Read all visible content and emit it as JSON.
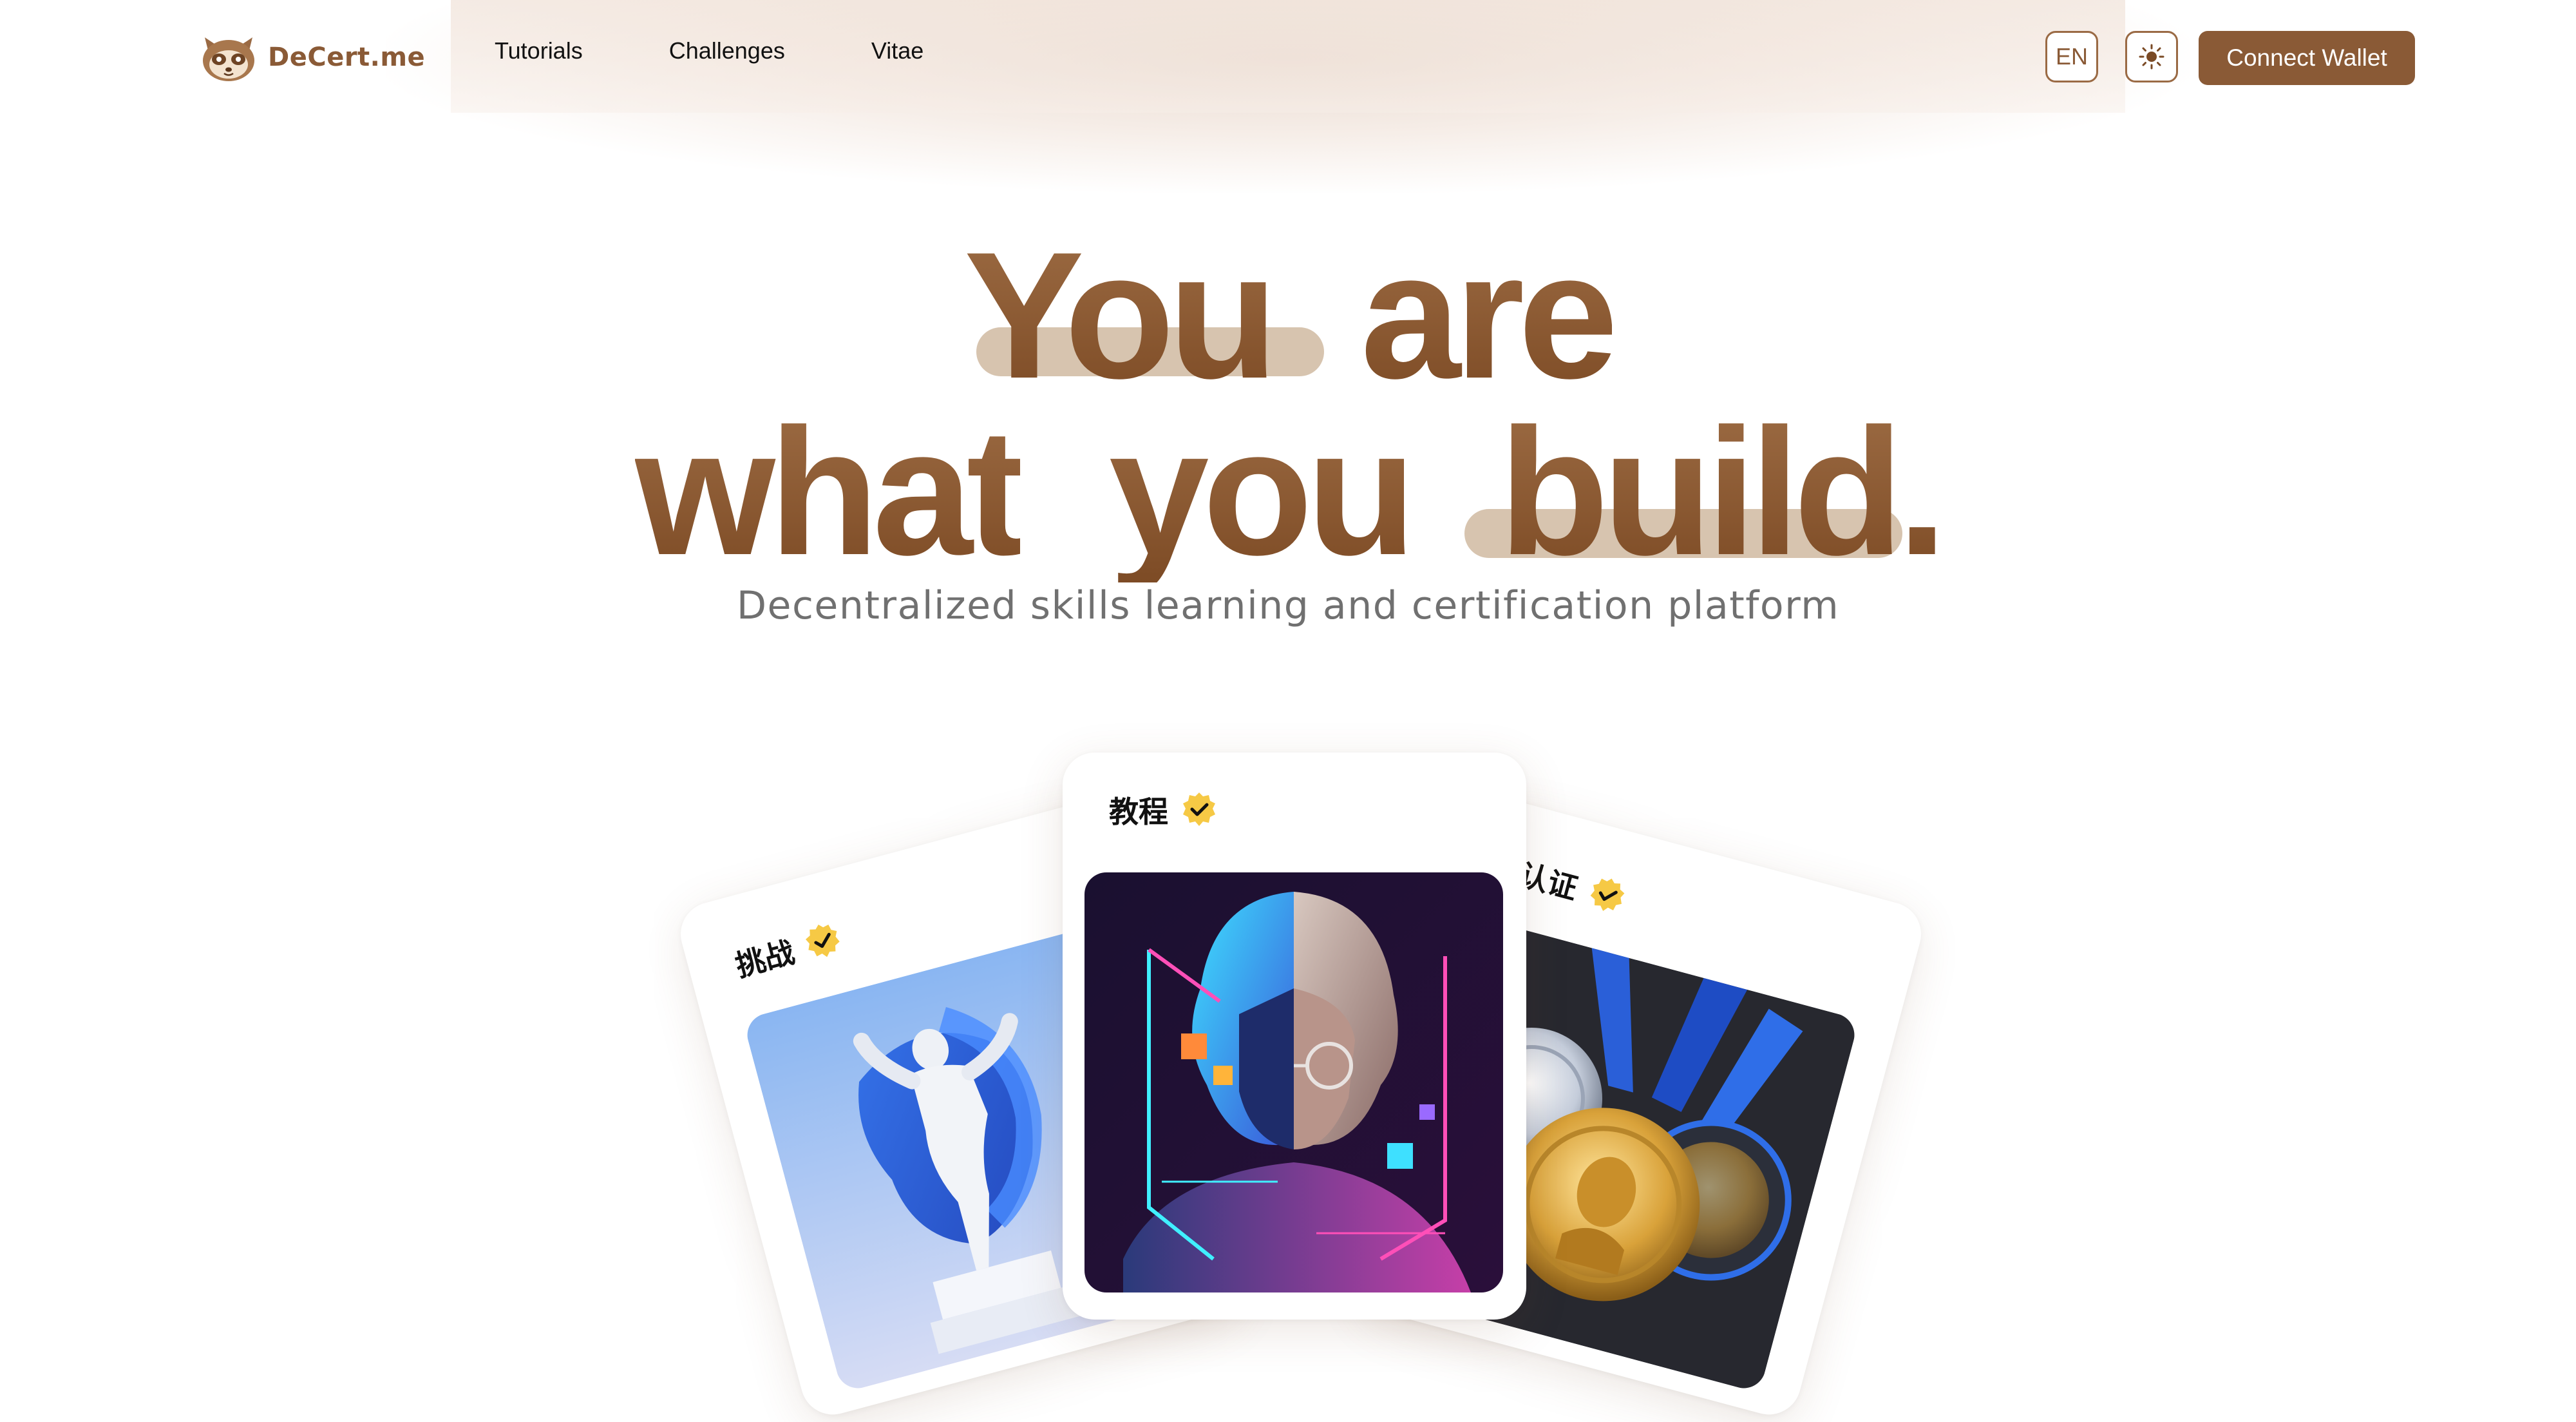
{
  "brand": {
    "name": "DeCert.me"
  },
  "nav": {
    "items": [
      "Tutorials",
      "Challenges",
      "Vitae"
    ]
  },
  "header": {
    "lang_label": "EN",
    "theme_icon": "sun-icon",
    "connect_label": "Connect Wallet"
  },
  "hero": {
    "line1_word1": "You",
    "line1_word2": "are",
    "line2_word1": "what",
    "line2_word2": "you",
    "line2_word3": "build.",
    "subtitle": "Decentralized skills learning and certification platform"
  },
  "cards": [
    {
      "title": "挑战",
      "icon": "verified-badge-icon",
      "image": "statue-image"
    },
    {
      "title": "教程",
      "icon": "verified-badge-icon",
      "image": "neon-portrait-image"
    },
    {
      "title": "认证",
      "icon": "verified-badge-icon",
      "image": "medals-image"
    }
  ],
  "colors": {
    "brand": "#8a5a36",
    "hero_text": "#8e5a33",
    "highlight": "#d9c6b3",
    "subtitle": "#707070",
    "badge": "#f6c945"
  }
}
